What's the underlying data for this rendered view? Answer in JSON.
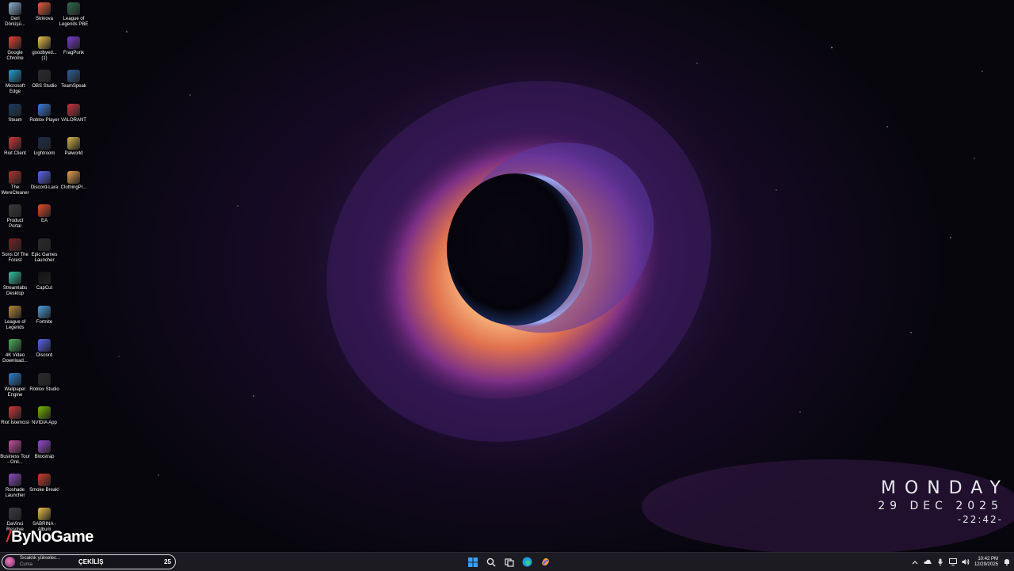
{
  "desktop": {
    "icons": [
      {
        "label": "Geri Dönüşü...",
        "icon": "recycle-bin-icon",
        "color": "#8fb4d9"
      },
      {
        "label": "Strinova",
        "icon": "strinova-icon",
        "color": "#e85b3c"
      },
      {
        "label": "League of Legends PBE",
        "icon": "lol-pbe-icon",
        "color": "#2f6b4f"
      },
      {
        "label": "Google Chrome",
        "icon": "chrome-icon",
        "color": "#e34133"
      },
      {
        "label": "goodbyed... (1)",
        "icon": "folder-icon",
        "color": "#f0c24b"
      },
      {
        "label": "FragPunk",
        "icon": "fragpunk-icon",
        "color": "#7b3bd1"
      },
      {
        "label": "Microsoft Edge",
        "icon": "edge-icon",
        "color": "#1fa0d8"
      },
      {
        "label": "OBS Studio",
        "icon": "obs-icon",
        "color": "#2b2b2f"
      },
      {
        "label": "TeamSpeak",
        "icon": "teamspeak-icon",
        "color": "#2d5e9a"
      },
      {
        "label": "Steam",
        "icon": "steam-icon",
        "color": "#1a3d63"
      },
      {
        "label": "Roblox Player",
        "icon": "roblox-icon",
        "color": "#3a7be0"
      },
      {
        "label": "VALORANT",
        "icon": "valorant-icon",
        "color": "#c93441"
      },
      {
        "label": "Riot Client",
        "icon": "riot-client-icon",
        "color": "#d13639"
      },
      {
        "label": "Lightroom",
        "icon": "lightroom-icon",
        "color": "#1a2c4a"
      },
      {
        "label": "Palworld",
        "icon": "palworld-icon",
        "color": "#d7b54a"
      },
      {
        "label": "The WereCleaner",
        "icon": "werecleaner-icon",
        "color": "#b0342e"
      },
      {
        "label": "Discord-Lara",
        "icon": "discord-icon",
        "color": "#5865f2"
      },
      {
        "label": "ClothingPr...",
        "icon": "folder-icon",
        "color": "#e8a04a"
      },
      {
        "label": "Product Portal",
        "icon": "product-portal-icon",
        "color": "#3a3a3a"
      },
      {
        "label": "EA",
        "icon": "ea-icon",
        "color": "#ea4a2a"
      },
      {
        "label": "Sons Of The Forest",
        "icon": "sons-forest-icon",
        "color": "#7a2222"
      },
      {
        "label": "Epic Games Launcher",
        "icon": "epic-games-icon",
        "color": "#2a2a2a"
      },
      {
        "label": "Streamlabs Desktop",
        "icon": "streamlabs-icon",
        "color": "#31c3a2"
      },
      {
        "label": "CapCut",
        "icon": "capcut-icon",
        "color": "#111111"
      },
      {
        "label": "League of Legends",
        "icon": "lol-icon",
        "color": "#b8883a"
      },
      {
        "label": "Fortnite",
        "icon": "fortnite-icon",
        "color": "#4aa0e0"
      },
      {
        "label": "4K Video Download...",
        "icon": "4k-video-icon",
        "color": "#4ab25a"
      },
      {
        "label": "Discord",
        "icon": "discord-icon",
        "color": "#5865f2"
      },
      {
        "label": "Wallpaper Engine",
        "icon": "wallpaper-engine-icon",
        "color": "#2a7fd4"
      },
      {
        "label": "Roblox Studio",
        "icon": "roblox-studio-icon",
        "color": "#2a2a2a"
      },
      {
        "label": "Riot İstemcisi",
        "icon": "riot-client-icon",
        "color": "#d13639"
      },
      {
        "label": "NVIDIA App",
        "icon": "nvidia-icon",
        "color": "#76b900"
      },
      {
        "label": "Business Tour - Onli...",
        "icon": "business-tour-icon",
        "color": "#c94fa0"
      },
      {
        "label": "Bloxstrap",
        "icon": "bloxstrap-icon",
        "color": "#9a4ad0"
      },
      {
        "label": "Roshade Launcher",
        "icon": "roshade-icon",
        "color": "#8a4ac0"
      },
      {
        "label": "Smoke Break!",
        "icon": "smoke-break-icon",
        "color": "#d03a2a"
      },
      {
        "label": "DaVinci Resolve",
        "icon": "davinci-icon",
        "color": "#3a3a44"
      },
      {
        "label": "SABRINA - Album",
        "icon": "folder-icon",
        "color": "#f0c24b"
      }
    ]
  },
  "clock": {
    "day": "MONDAY",
    "date": "29 DEC 2025",
    "time": "-22:42-"
  },
  "watermark": {
    "text": "ByNoGame"
  },
  "taskbar": {
    "weather_line1": "Sıcaklık yükselec...",
    "weather_line2": "Cuma",
    "promo_label": "ÇEKİLİŞ",
    "promo_count": "25",
    "tray_time": "10:42 PM",
    "tray_date": "12/29/2025",
    "accent": "#0a84ff"
  }
}
